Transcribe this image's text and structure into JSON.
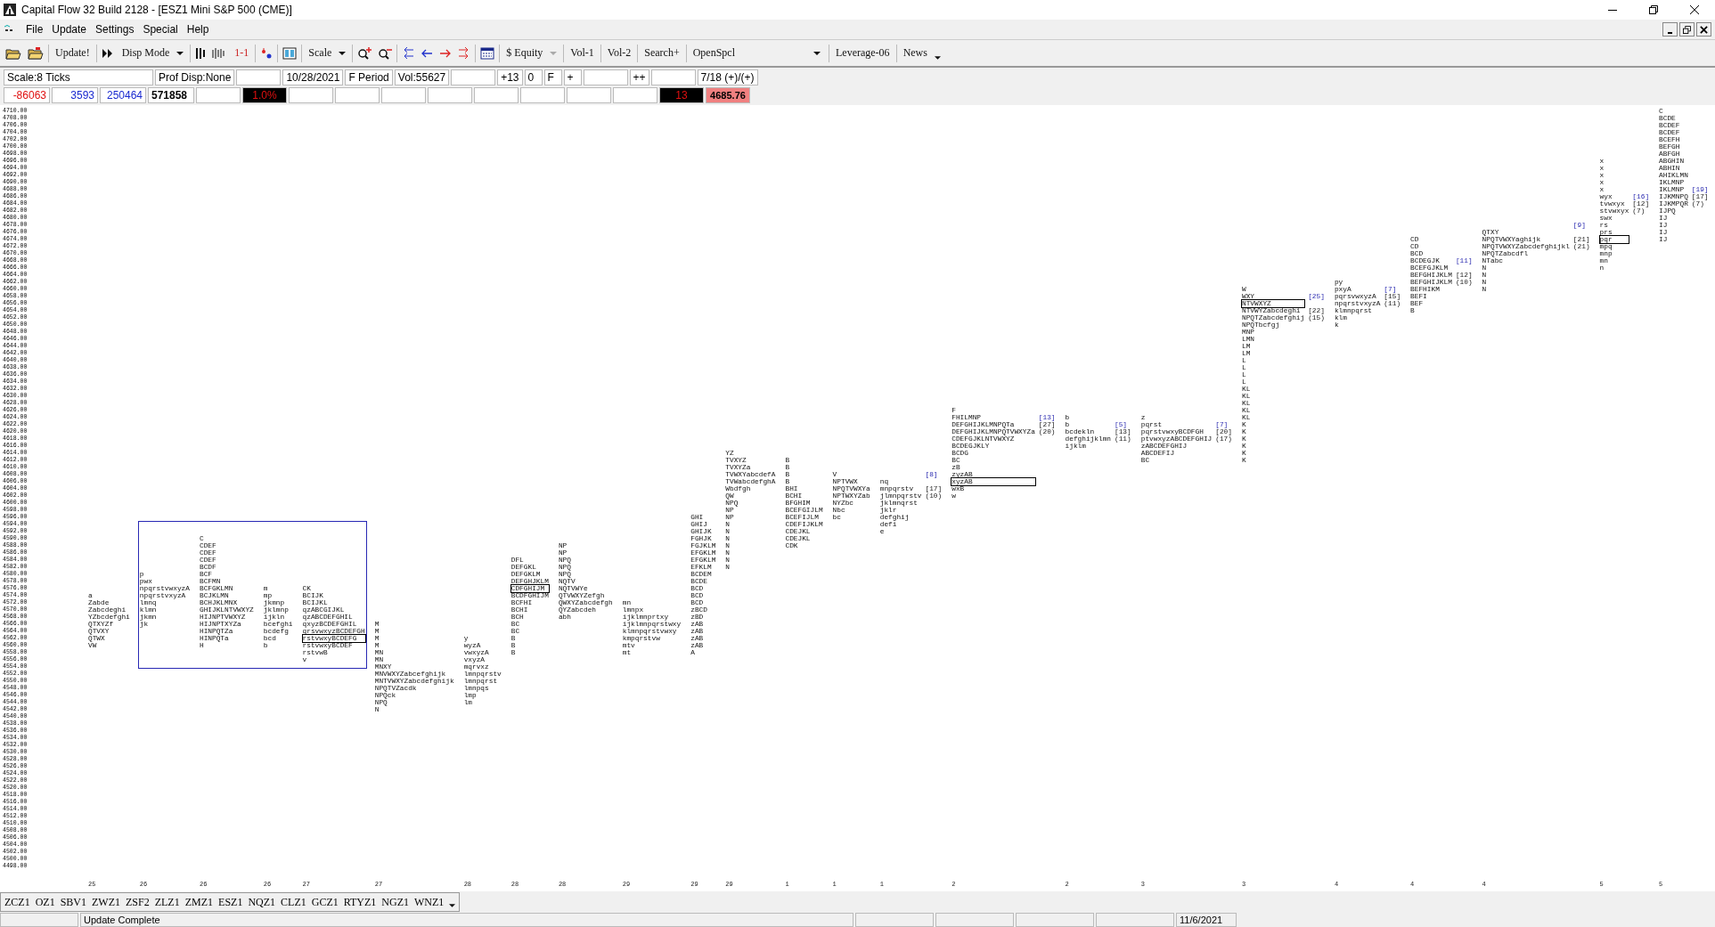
{
  "window": {
    "title": "Capital Flow 32  Build 2128 - [ESZ1  Mini S&P 500 (CME)]"
  },
  "menu": [
    "File",
    "Update",
    "Settings",
    "Special",
    "Help"
  ],
  "toolbar": {
    "update": "Update!",
    "disp_mode": "Disp Mode",
    "one_to_one": "1-1",
    "scale": "Scale",
    "equity": {
      "label": "$ Equity",
      "disabled": true
    },
    "vol1": "Vol-1",
    "vol2": "Vol-2",
    "search": "Search+",
    "open_special": "OpenSpcl",
    "leverage": "Leverage-06",
    "news": "News"
  },
  "info_row": [
    {
      "text": "Scale:8 Ticks",
      "kind": "wide"
    },
    {
      "text": "Prof Disp:None",
      "kind": "field"
    },
    {
      "kind": "blank"
    },
    {
      "text": "10/28/2021",
      "kind": "field"
    },
    {
      "text": "F Period",
      "kind": "field"
    },
    {
      "text": "Vol:55627",
      "kind": "field"
    },
    {
      "kind": "blank"
    },
    {
      "text": "+13",
      "kind": "field"
    },
    {
      "text": "0",
      "kind": "field"
    },
    {
      "text": "F",
      "kind": "field"
    },
    {
      "text": "+",
      "kind": "field"
    },
    {
      "kind": "blank"
    },
    {
      "text": "++",
      "kind": "field"
    },
    {
      "kind": "blank"
    },
    {
      "text": "7/18 (+)/(+)",
      "kind": "field"
    }
  ],
  "stats_row": [
    {
      "text": "-86063",
      "kind": "negative"
    },
    {
      "text": "3593",
      "kind": "positive"
    },
    {
      "text": "250464",
      "kind": "positive"
    },
    {
      "text": "571858",
      "kind": "total"
    },
    {
      "kind": "blank"
    },
    {
      "text": "1.0%",
      "kind": "alert"
    },
    {
      "kind": "blank"
    },
    {
      "kind": "blank"
    },
    {
      "kind": "blank"
    },
    {
      "kind": "blank"
    },
    {
      "kind": "blank"
    },
    {
      "kind": "blank"
    },
    {
      "kind": "blank"
    },
    {
      "kind": "blank"
    },
    {
      "text": "13",
      "kind": "alert"
    },
    {
      "text": "4685.76",
      "kind": "price"
    }
  ],
  "chart": {
    "y_axis": [
      "4710.00",
      "4708.00",
      "4706.00",
      "4704.00",
      "4702.00",
      "4700.00",
      "4698.00",
      "4696.00",
      "4694.00",
      "4692.00",
      "4690.00",
      "4688.00",
      "4686.00",
      "4684.00",
      "4682.00",
      "4680.00",
      "4678.00",
      "4676.00",
      "4674.00",
      "4672.00",
      "4670.00",
      "4668.00",
      "4666.00",
      "4664.00",
      "4662.00",
      "4660.00",
      "4658.00",
      "4656.00",
      "4654.00",
      "4652.00",
      "4650.00",
      "4648.00",
      "4646.00",
      "4644.00",
      "4642.00",
      "4640.00",
      "4638.00",
      "4636.00",
      "4634.00",
      "4632.00",
      "4630.00",
      "4628.00",
      "4626.00",
      "4624.00",
      "4622.00",
      "4620.00",
      "4618.00",
      "4616.00",
      "4614.00",
      "4612.00",
      "4610.00",
      "4608.00",
      "4606.00",
      "4604.00",
      "4602.00",
      "4600.00",
      "4598.00",
      "4596.00",
      "4594.00",
      "4592.00",
      "4590.00",
      "4588.00",
      "4586.00",
      "4584.00",
      "4582.00",
      "4580.00",
      "4578.00",
      "4576.00",
      "4574.00",
      "4572.00",
      "4570.00",
      "4568.00",
      "4566.00",
      "4564.00",
      "4562.00",
      "4560.00",
      "4558.00",
      "4556.00",
      "4554.00",
      "4552.00",
      "4550.00",
      "4548.00",
      "4546.00",
      "4544.00",
      "4542.00",
      "4540.00",
      "4538.00",
      "4536.00",
      "4534.00",
      "4532.00",
      "4530.00",
      "4528.00",
      "4526.00",
      "4524.00",
      "4522.00",
      "4520.00",
      "4518.00",
      "4516.00",
      "4514.00",
      "4512.00",
      "4510.00",
      "4508.00",
      "4506.00",
      "4504.00",
      "4502.00",
      "4500.00",
      "4498.00"
    ],
    "profiles": [
      {
        "date": "25",
        "highlighted": false,
        "lines": [
          "a",
          "Zabde",
          "Zabcdeghi",
          "YZbcdefghi",
          "QTXYZf",
          "QTVXY",
          "QTWX",
          "VW"
        ]
      },
      {
        "date": "26",
        "highlighted": true,
        "lines": [
          "p",
          "pwx",
          "npqrstvwxyzA",
          "npqrstvxyzA",
          "lmnq",
          "klmn",
          "jkmn",
          "jk"
        ]
      },
      {
        "date": "26",
        "highlighted": true,
        "lines": [
          "C",
          "CDEF",
          "CDEF",
          "CDEF",
          "BCDF",
          "BCF",
          "BCFMN",
          "BCFGKLMN",
          "BCJKLMN",
          "BCHJKLMNX",
          "GHIJKLNTVWXYZ",
          "HIJNPTVWXYZ",
          "HIJNPTXYZa",
          "HINPQTZa",
          "HINPQTa",
          "H"
        ]
      },
      {
        "date": "26",
        "highlighted": true,
        "lines": [
          "m",
          "mp",
          "jkmnp",
          "jklmnp",
          "ijkln",
          "bcefghi",
          "bcdefg",
          "bcd",
          "b"
        ]
      },
      {
        "date": "27",
        "highlighted": true,
        "lines": [
          "CK",
          "BCIJK",
          "BCIJKL",
          "qzABCGIJKL",
          "qzABCDEFGHIL",
          "qxyzBCDEFGHIL",
          "qrsvwxyzBCDEFGH",
          {
            "text": "rstvwxyBCDEFG",
            "boxed": true
          },
          "rstvwxyBCDEF",
          "rstvwB",
          "v"
        ]
      },
      {
        "date": "27",
        "highlighted": false,
        "lines": [
          "M",
          "M",
          "M",
          "M",
          "MN",
          "MN",
          "MNXY",
          "MNVWXYZabcefghijk",
          "MNTVWXYZabcdefghijk",
          "NPQTVZacdk",
          "NPQck",
          "NPQ",
          "N"
        ]
      },
      {
        "date": "28",
        "highlighted": false,
        "lines": [
          "y",
          "wyzA",
          "vwxyzA",
          "vxyzA",
          "mqrvxz",
          "lmnpqrstv",
          "lmnpqrst",
          "lmnpqs",
          "lmp",
          "lm"
        ]
      },
      {
        "date": "28",
        "highlighted": false,
        "lines": [
          "DFL",
          "DEFGKL",
          "DEFGKLM",
          "DEFGHJKLM",
          {
            "text": "CDFGHIJM",
            "boxed": true
          },
          "BCDFGHIJM",
          "BCFHI",
          "BCHI",
          "BCH",
          "BC",
          "BC",
          "B",
          "B",
          "B"
        ]
      },
      {
        "date": "28",
        "highlighted": false,
        "lines": [
          "NP",
          "NP",
          "NPQ",
          "NPQ",
          "NPQ",
          "NQTV",
          "NQTVWYe",
          "QTVWXYZefgh",
          "QWXYZabcdefgh",
          "QYZabcdeh",
          "abh"
        ]
      },
      {
        "date": "29",
        "highlighted": false,
        "lines": [
          "mn",
          "lmnpx",
          "ijklmnprtxy",
          "ijklmnpqrstwxy",
          "klmnpqrstvwxy",
          "kmpqrstvw",
          "mtv",
          "mt"
        ]
      },
      {
        "date": "29",
        "highlighted": false,
        "lines": [
          "GHI",
          "GHIJ",
          "GHIJK",
          "FGHJK",
          "FGJKLM",
          "EFGKLM",
          "EFGKLM",
          "EFKLM",
          "BCDEM",
          "BCDE",
          "BCD",
          "BCD",
          "BCD",
          "zBCD",
          "zBD",
          "zAB",
          "zAB",
          "zAB",
          "zAB",
          "A"
        ]
      },
      {
        "date": "29",
        "highlighted": false,
        "lines": [
          "YZ",
          "TVXYZ",
          "TVXYZa",
          "TVWXYabcdefA",
          "TVWabcdefghA",
          "Wbdfgh",
          "QW",
          "NPQ",
          "NP",
          "NP",
          "N",
          "N",
          "N",
          "N",
          "N",
          "N",
          "N"
        ]
      },
      {
        "date": "1",
        "highlighted": false,
        "lines": [
          "B",
          "B",
          "B",
          "B",
          "BHI",
          "BCHI",
          "BFGHIM",
          "BCEFGIJLM",
          "BCEFIJLM",
          "CDEFIJKLM",
          "CDEJKL",
          "CDEJKL",
          "CDK"
        ]
      },
      {
        "date": "1",
        "highlighted": false,
        "lines": [
          "V",
          "NPTVWX",
          "NPQTVWXYa",
          "NPTWXYZab",
          "NYZbc",
          "Nbc",
          "bc"
        ]
      },
      {
        "date": "1",
        "highlighted": false,
        "lines": [
          "nq",
          "mnpqrstv",
          "jlmnpqrstv",
          "jklmnqrst",
          "jklr",
          "defghij",
          "defi",
          "e"
        ],
        "notes": [
          {
            "text": "[8]",
            "kind": "count"
          },
          {
            "text": "[17]",
            "kind": "value"
          },
          {
            "text": "(10)",
            "kind": "value"
          }
        ]
      },
      {
        "date": "2",
        "highlighted": false,
        "lines": [
          "F",
          "FHILMNP",
          "DEFGHIJKLMNPQTa",
          "DEFGHIJKLMNPQTVWXYZa",
          "CDEFGJKLNTVWXYZ",
          "BCDEGJKLY",
          "BCDG",
          "BC",
          "zB",
          "zyzAB",
          {
            "text": "xyzAB",
            "boxed": true
          },
          "wxB",
          "w"
        ],
        "notes": [
          {
            "text": "[13]",
            "kind": "count"
          },
          {
            "text": "[27]",
            "kind": "value"
          },
          {
            "text": "(20)",
            "kind": "value"
          }
        ]
      },
      {
        "date": "2",
        "highlighted": false,
        "lines": [
          "b",
          "b",
          "bcdekln",
          "defghijklmn",
          "ijklm"
        ],
        "notes": [
          {
            "text": "[5]",
            "kind": "count"
          },
          {
            "text": "[13]",
            "kind": "value"
          },
          {
            "text": "(11)",
            "kind": "value"
          }
        ]
      },
      {
        "date": "3",
        "highlighted": false,
        "lines": [
          "z",
          "pqrst",
          "pqrstvwxyBCDFGH",
          "ptvwxyzABCDEFGHIJ",
          "zABCDEFGHIJ",
          "ABCDEFIJ",
          "BC"
        ],
        "notes": [
          {
            "text": "[7]",
            "kind": "count"
          },
          {
            "text": "[20]",
            "kind": "value"
          },
          {
            "text": "(17)",
            "kind": "value"
          }
        ]
      },
      {
        "date": "3",
        "highlighted": false,
        "lines": [
          "W",
          "WXY",
          {
            "text": "NTVWXYZ",
            "boxed": true
          },
          "NTVWYZabcdeghi",
          "NPQTZabcdefghij",
          "NPQTbcfgj",
          "MNP",
          "LMN",
          "LM",
          "LM",
          "L",
          "L",
          "L",
          "L",
          "KL",
          "KL",
          "KL",
          "KL",
          "KL",
          "K",
          "K",
          "K",
          "K",
          "K",
          "K"
        ],
        "notes": [
          {
            "text": "[25]",
            "kind": "count"
          },
          {
            "text": "[22]",
            "kind": "value"
          },
          {
            "text": "(15)",
            "kind": "value"
          }
        ]
      },
      {
        "date": "4",
        "highlighted": false,
        "lines": [
          "py",
          "pxyA",
          "pqrsvwxyzA",
          "npqrstvxyzA",
          "klmnpqrst",
          "klm",
          "k"
        ],
        "notes": [
          {
            "text": "[7]",
            "kind": "count"
          },
          {
            "text": "[15]",
            "kind": "value"
          },
          {
            "text": "(11)",
            "kind": "value"
          }
        ]
      },
      {
        "date": "4",
        "highlighted": false,
        "lines": [
          "CD",
          "CD",
          "BCD",
          "BCDEGJK",
          "BCEFGJKLM",
          "BEFGHIJKLM",
          "BEFGHIJKLM",
          "BEFHIKM",
          "BEFI",
          "BEF",
          "B"
        ],
        "notes": [
          {
            "text": "[11]",
            "kind": "count"
          },
          {
            "text": "[12]",
            "kind": "value"
          },
          {
            "text": "(10)",
            "kind": "value"
          }
        ]
      },
      {
        "date": "4",
        "highlighted": false,
        "lines": [
          "QTXY",
          "NPQTVWXYaghijk",
          "NPQTVWXYZabcdefghijkl",
          "NPQTZabcdfl",
          "NTabc",
          "N",
          "N",
          "N",
          "N"
        ],
        "notes": [
          {
            "text": "[9]",
            "kind": "count"
          },
          {
            "text": "[21]",
            "kind": "value"
          },
          {
            "text": "(21)",
            "kind": "value"
          }
        ]
      },
      {
        "date": "5",
        "highlighted": false,
        "lines": [
          "x",
          "x",
          "x",
          "x",
          "x",
          "wyx",
          "tvwxyx",
          "stvwxyx",
          "swx",
          "rs",
          "prs",
          {
            "text": "pqr",
            "boxed": true
          },
          "mpq",
          "mnp",
          "mn",
          "n"
        ],
        "notes": [
          {
            "text": "[16]",
            "kind": "count"
          },
          {
            "text": "[12]",
            "kind": "value"
          },
          {
            "text": "(7)",
            "kind": "value"
          }
        ]
      },
      {
        "date": "5",
        "highlighted": false,
        "lines": [
          "C",
          "BCDE",
          "BCDEF",
          "BCDEF",
          "BCEFH",
          "BEFGH",
          "ABFGH",
          "ABGHIN",
          "ABHIN",
          "AHIKLMN",
          "IKLMNP",
          "IKLMNP",
          "IJKMNPQ",
          "IJKMPQR",
          "IJPQ",
          "IJ",
          "IJ",
          "IJ",
          "IJ"
        ],
        "notes": [
          {
            "text": "[19]",
            "kind": "count"
          },
          {
            "text": "[17]",
            "kind": "value"
          },
          {
            "text": "(7)",
            "kind": "value"
          }
        ]
      }
    ]
  },
  "symbols": [
    "ZCZ1",
    "OZ1",
    "SBV1",
    "ZWZ1",
    "ZSF2",
    "ZLZ1",
    "ZMZ1",
    "ESZ1",
    "NQZ1",
    "CLZ1",
    "GCZ1",
    "RTYZ1",
    "NGZ1",
    "WNZ1"
  ],
  "status_bar": [
    {
      "kind": "blank"
    },
    {
      "text": "Update Complete",
      "kind": "message"
    },
    {
      "kind": "blank"
    },
    {
      "kind": "blank"
    },
    {
      "kind": "blank"
    },
    {
      "kind": "blank"
    },
    {
      "text": "11/6/2021",
      "kind": "field"
    }
  ]
}
